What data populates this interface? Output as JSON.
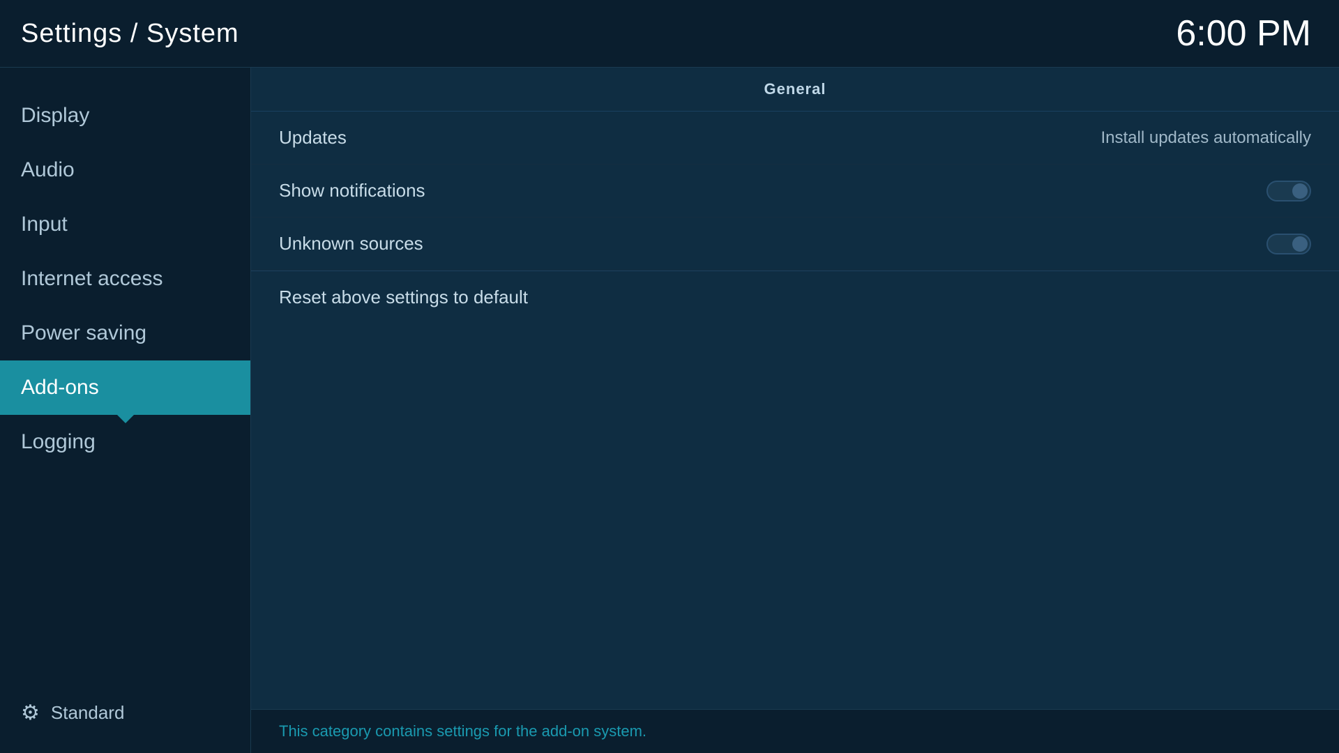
{
  "header": {
    "title": "Settings / System",
    "time": "6:00 PM"
  },
  "sidebar": {
    "items": [
      {
        "id": "display",
        "label": "Display",
        "active": false
      },
      {
        "id": "audio",
        "label": "Audio",
        "active": false
      },
      {
        "id": "input",
        "label": "Input",
        "active": false
      },
      {
        "id": "internet-access",
        "label": "Internet access",
        "active": false
      },
      {
        "id": "power-saving",
        "label": "Power saving",
        "active": false
      },
      {
        "id": "add-ons",
        "label": "Add-ons",
        "active": true
      },
      {
        "id": "logging",
        "label": "Logging",
        "active": false
      }
    ],
    "bottom_label": "Standard",
    "gear_icon": "⚙"
  },
  "main": {
    "section_header": "General",
    "rows": [
      {
        "id": "updates",
        "label": "Updates",
        "value": "Install updates automatically",
        "type": "value"
      },
      {
        "id": "show-notifications",
        "label": "Show notifications",
        "value": "",
        "type": "toggle",
        "toggle_state": false
      },
      {
        "id": "unknown-sources",
        "label": "Unknown sources",
        "value": "",
        "type": "toggle",
        "toggle_state": false
      }
    ],
    "reset_row": {
      "label": "Reset above settings to default"
    },
    "footer_text": "This category contains settings for the add-on system."
  }
}
